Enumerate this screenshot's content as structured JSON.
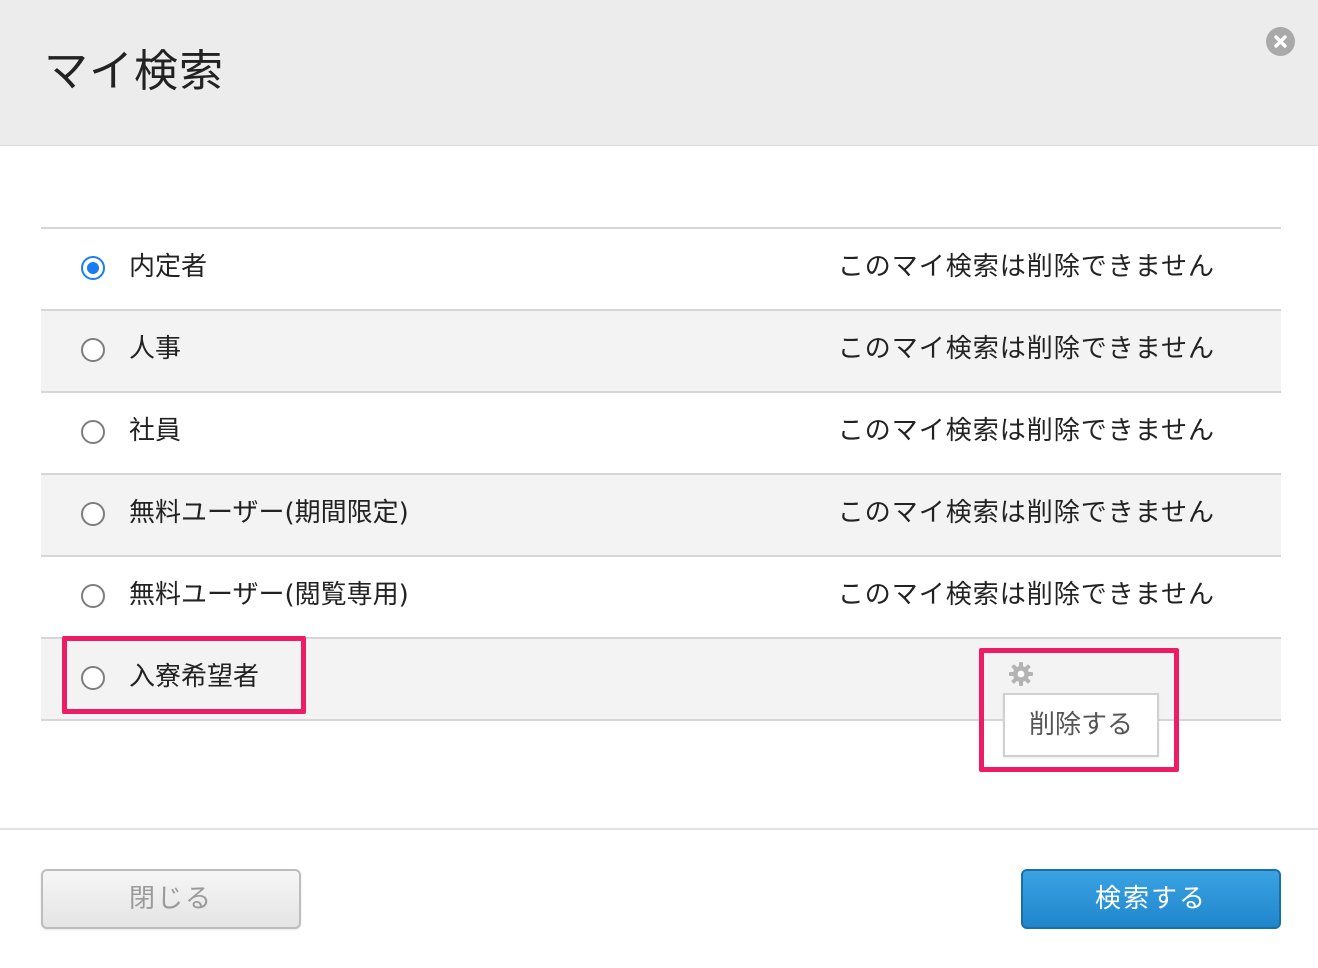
{
  "dialog": {
    "title": "マイ検索",
    "close_icon": "close-icon"
  },
  "list": {
    "items": [
      {
        "label": "内定者",
        "note": "このマイ検索は削除できません",
        "selected": true
      },
      {
        "label": "人事",
        "note": "このマイ検索は削除できません",
        "selected": false
      },
      {
        "label": "社員",
        "note": "このマイ検索は削除できません",
        "selected": false
      },
      {
        "label": "無料ユーザー(期間限定)",
        "note": "このマイ検索は削除できません",
        "selected": false
      },
      {
        "label": "無料ユーザー(閲覧専用)",
        "note": "このマイ検索は削除できません",
        "selected": false
      },
      {
        "label": "入寮希望者",
        "note": "",
        "selected": false
      }
    ],
    "settings_icon": "gear-icon",
    "delete_popup_label": "削除する"
  },
  "footer": {
    "close_label": "閉じる",
    "search_label": "検索する"
  },
  "colors": {
    "accent": "#1a7cf2",
    "primary_button": "#2a94d6",
    "highlight": "#ee1c64",
    "header_bg": "#ececec"
  }
}
